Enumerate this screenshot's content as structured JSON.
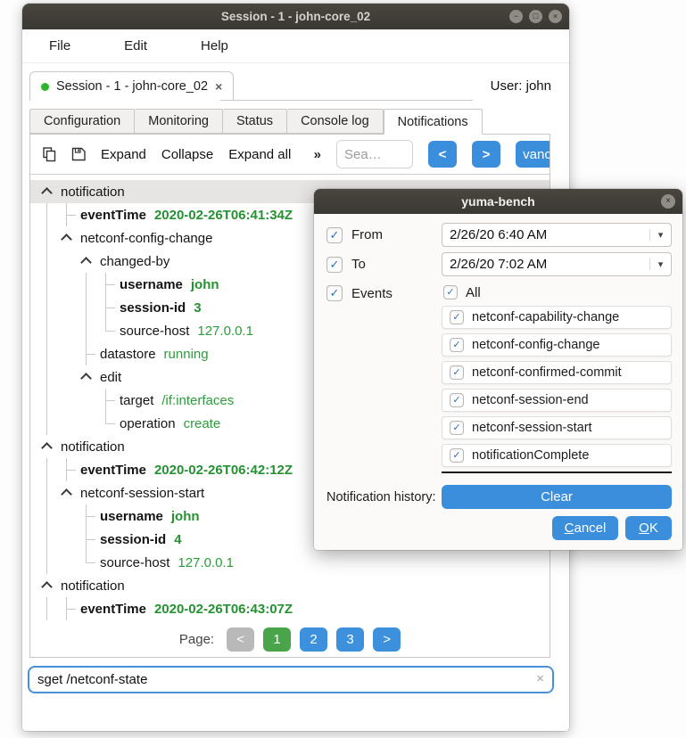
{
  "window": {
    "title": "Session - 1 - john-core_02",
    "controls": {
      "minimize": "−",
      "maximize": "□",
      "close": "×"
    }
  },
  "menu": {
    "items": [
      {
        "label": "File"
      },
      {
        "label": "Edit"
      },
      {
        "label": "Help"
      }
    ]
  },
  "session_tab": {
    "label": "Session - 1 - john-core_02",
    "close": "×",
    "user": "User: john"
  },
  "tabs": [
    {
      "label": "Configuration"
    },
    {
      "label": "Monitoring"
    },
    {
      "label": "Status"
    },
    {
      "label": "Console log"
    },
    {
      "label": "Notifications"
    }
  ],
  "toolbar": {
    "expand": "Expand",
    "collapse": "Collapse",
    "expand_all": "Expand all",
    "overflow": "»",
    "search_placeholder": "Sea…",
    "prev": "<",
    "next": ">",
    "advanced": "vanc"
  },
  "tree": {
    "rows": [
      {
        "lvl": 0,
        "branch": true,
        "label": "notification",
        "sel": true,
        "g": []
      },
      {
        "lvl": 1,
        "conn": "t",
        "bold": true,
        "label": "eventTime",
        "value": "2020-02-26T06:41:34Z",
        "g": [
          0
        ]
      },
      {
        "lvl": 1,
        "branch": true,
        "label": "netconf-config-change",
        "g": [
          0
        ]
      },
      {
        "lvl": 2,
        "branch": true,
        "label": "changed-by",
        "g": [
          0
        ]
      },
      {
        "lvl": 3,
        "conn": "t",
        "bold": true,
        "label": "username",
        "value": "john",
        "g": [
          0,
          2
        ]
      },
      {
        "lvl": 3,
        "conn": "t",
        "bold": true,
        "label": "session-id",
        "value": "3",
        "g": [
          0,
          2
        ]
      },
      {
        "lvl": 3,
        "conn": "e",
        "label": "source-host",
        "value": "127.0.0.1",
        "g": [
          0,
          2
        ]
      },
      {
        "lvl": 2,
        "conn": "t",
        "label": "datastore",
        "value": "running",
        "g": [
          0
        ]
      },
      {
        "lvl": 2,
        "branch": true,
        "label": "edit",
        "g": [
          0
        ]
      },
      {
        "lvl": 3,
        "conn": "t",
        "label": "target",
        "value": "/if:interfaces",
        "g": [
          0
        ]
      },
      {
        "lvl": 3,
        "conn": "e",
        "label": "operation",
        "value": "create",
        "g": [
          0
        ]
      },
      {
        "lvl": 0,
        "branch": true,
        "label": "notification",
        "g": []
      },
      {
        "lvl": 1,
        "conn": "t",
        "bold": true,
        "label": "eventTime",
        "value": "2020-02-26T06:42:12Z",
        "g": [
          0
        ]
      },
      {
        "lvl": 1,
        "branch": true,
        "label": "netconf-session-start",
        "g": [
          0
        ]
      },
      {
        "lvl": 2,
        "conn": "t",
        "bold": true,
        "label": "username",
        "value": "john",
        "g": [
          0
        ]
      },
      {
        "lvl": 2,
        "conn": "t",
        "bold": true,
        "label": "session-id",
        "value": "4",
        "g": [
          0
        ]
      },
      {
        "lvl": 2,
        "conn": "e",
        "label": "source-host",
        "value": "127.0.0.1",
        "g": [
          0
        ]
      },
      {
        "lvl": 0,
        "branch": true,
        "label": "notification",
        "g": []
      },
      {
        "lvl": 1,
        "conn": "t",
        "bold": true,
        "label": "eventTime",
        "value": "2020-02-26T06:43:07Z",
        "g": [
          0
        ]
      }
    ]
  },
  "pager": {
    "label": "Page:",
    "buttons": [
      {
        "label": "<",
        "style": "gray"
      },
      {
        "label": "1",
        "style": "green"
      },
      {
        "label": "2",
        "style": "blue"
      },
      {
        "label": "3",
        "style": "blue"
      },
      {
        "label": ">",
        "style": "blue"
      }
    ]
  },
  "command": {
    "value": "sget /netconf-state",
    "clear": "×"
  },
  "dialog": {
    "title": "yuma-bench",
    "close": "×",
    "from": {
      "label": "From",
      "value": "2/26/20 6:40 AM"
    },
    "to": {
      "label": "To",
      "value": "2/26/20 7:02 AM"
    },
    "events_label": "Events",
    "all_label": "All",
    "events": [
      "netconf-capability-change",
      "netconf-config-change",
      "netconf-confirmed-commit",
      "netconf-session-end",
      "netconf-session-start",
      "notificationComplete"
    ],
    "history_label": "Notification history:",
    "clear_label": "Clear",
    "cancel_label": "Cancel",
    "ok_label": "OK"
  },
  "icons": {
    "check": "✓",
    "dropdown_arrow": "▾"
  },
  "colors": {
    "accent_blue": "#3a8edc",
    "accent_green": "#4aa54a",
    "value_green": "#2e9b3e",
    "titlebar": "#3f3d39"
  }
}
